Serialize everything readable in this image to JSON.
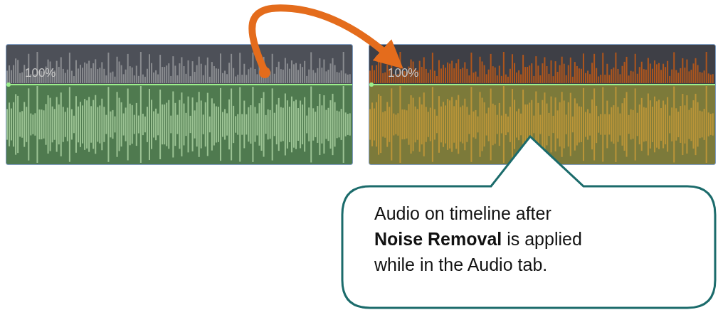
{
  "clips": [
    {
      "kind": "original",
      "volume": "100%"
    },
    {
      "kind": "denoised",
      "volume": "100%"
    }
  ],
  "callout": {
    "lines": [
      "Audio on timeline after",
      "**Noise Removal** is applied",
      "while in the Audio tab."
    ]
  }
}
